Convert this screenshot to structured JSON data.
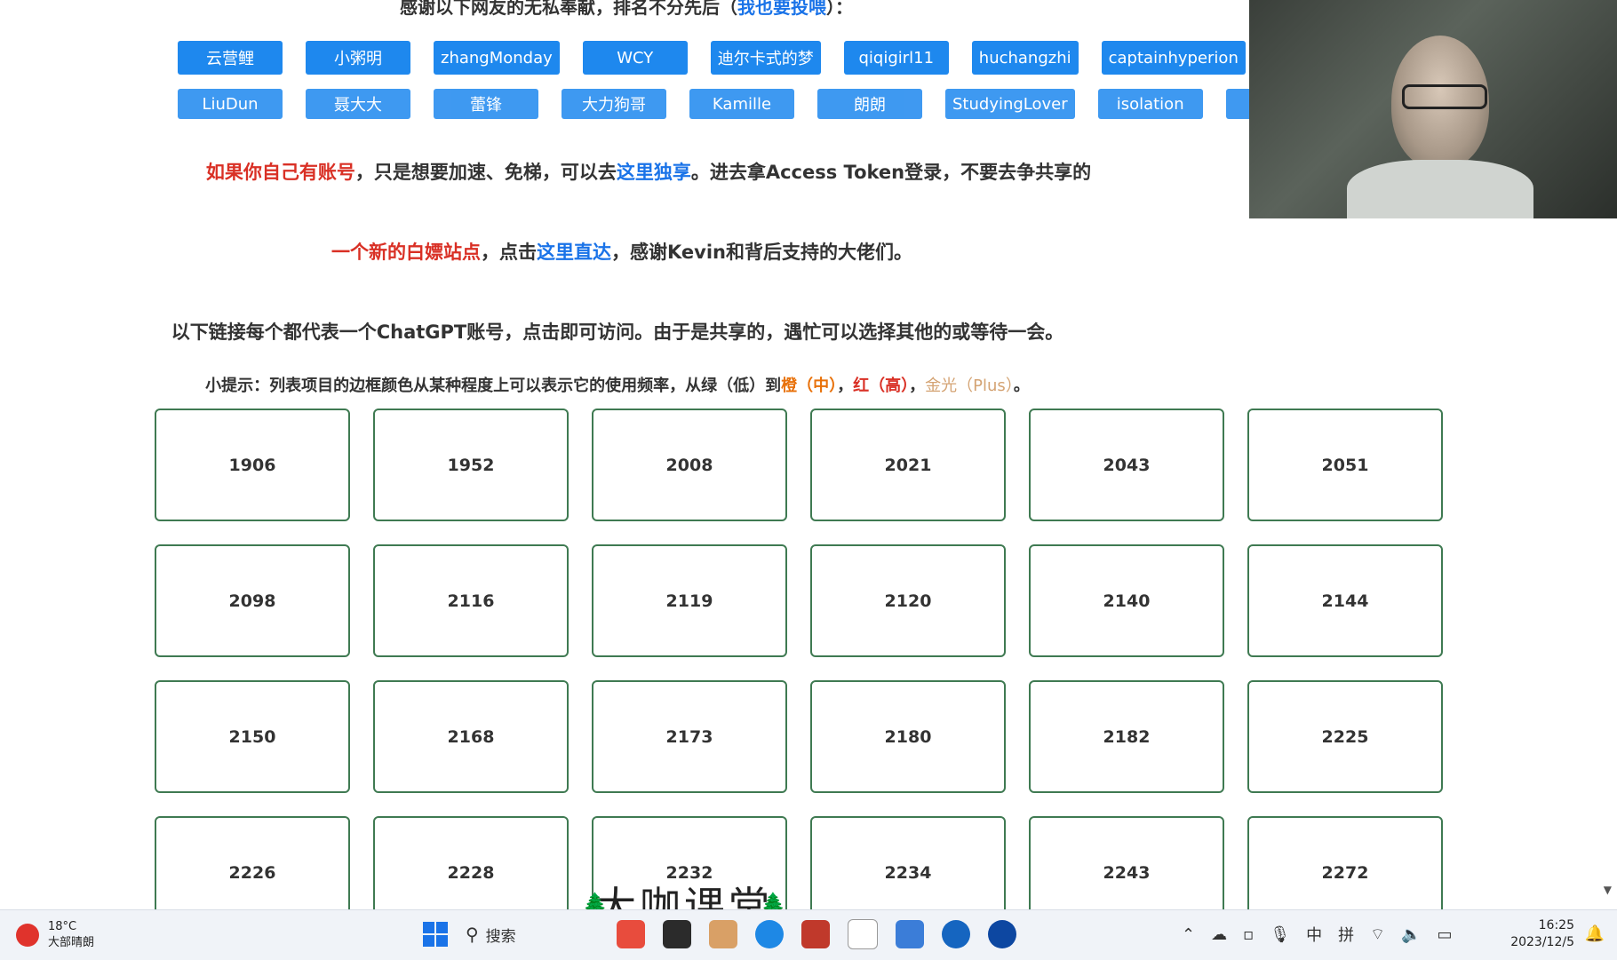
{
  "header": {
    "thanks_text": "感谢以下网友的无私奉献，排名不分先后（",
    "thanks_link": "我也要投喂",
    "thanks_tail": "）："
  },
  "donors_row1": [
    "云营鲤",
    "小粥明",
    "zhangMonday",
    "WCY",
    "迪尔卡式的梦",
    "qiqigirl11",
    "huchangzhi",
    "captainhyperion"
  ],
  "donors_row2": [
    "LiuDun",
    "聂大大",
    "蕾锋",
    "大力狗哥",
    "Kamille",
    "朗朗",
    "StudyingLover",
    "isolation",
    ""
  ],
  "notice1": {
    "red": "如果你自己有账号",
    "text1": "，只是想要加速、免梯，可以去",
    "link": "这里独享",
    "text2": "。进去拿Access Token登录，不要去争共享的"
  },
  "notice2": {
    "red": "一个新的白嫖站点",
    "text1": "，点击",
    "link": "这里直达",
    "text2": "，感谢Kevin和背后支持的大佬们。"
  },
  "notice3": "以下链接每个都代表一个ChatGPT账号，点击即可访问。由于是共享的，遇忙可以选择其他的或等待一会。",
  "tip": {
    "prefix": "小提示：列表项目的边框颜色从某种程度上可以表示它的使用频率，从绿（低）到",
    "orange": "橙（中）",
    "sep1": "，",
    "red": "红（高）",
    "sep2": "，",
    "gold": "金光（Plus）",
    "suffix": "。"
  },
  "accounts": [
    "1906",
    "1952",
    "2008",
    "2021",
    "2043",
    "2051",
    "2098",
    "2116",
    "2119",
    "2120",
    "2140",
    "2144",
    "2150",
    "2168",
    "2173",
    "2180",
    "2182",
    "2225",
    "2226",
    "2228",
    "2232",
    "2234",
    "2243",
    "2272"
  ],
  "watermark": "大咖课堂",
  "taskbar": {
    "temp": "18°C",
    "weather": "大部晴朗",
    "search_label": "搜索",
    "tray_ime1": "中",
    "tray_ime2": "拼",
    "time": "16:25",
    "date": "2023/12/5"
  }
}
